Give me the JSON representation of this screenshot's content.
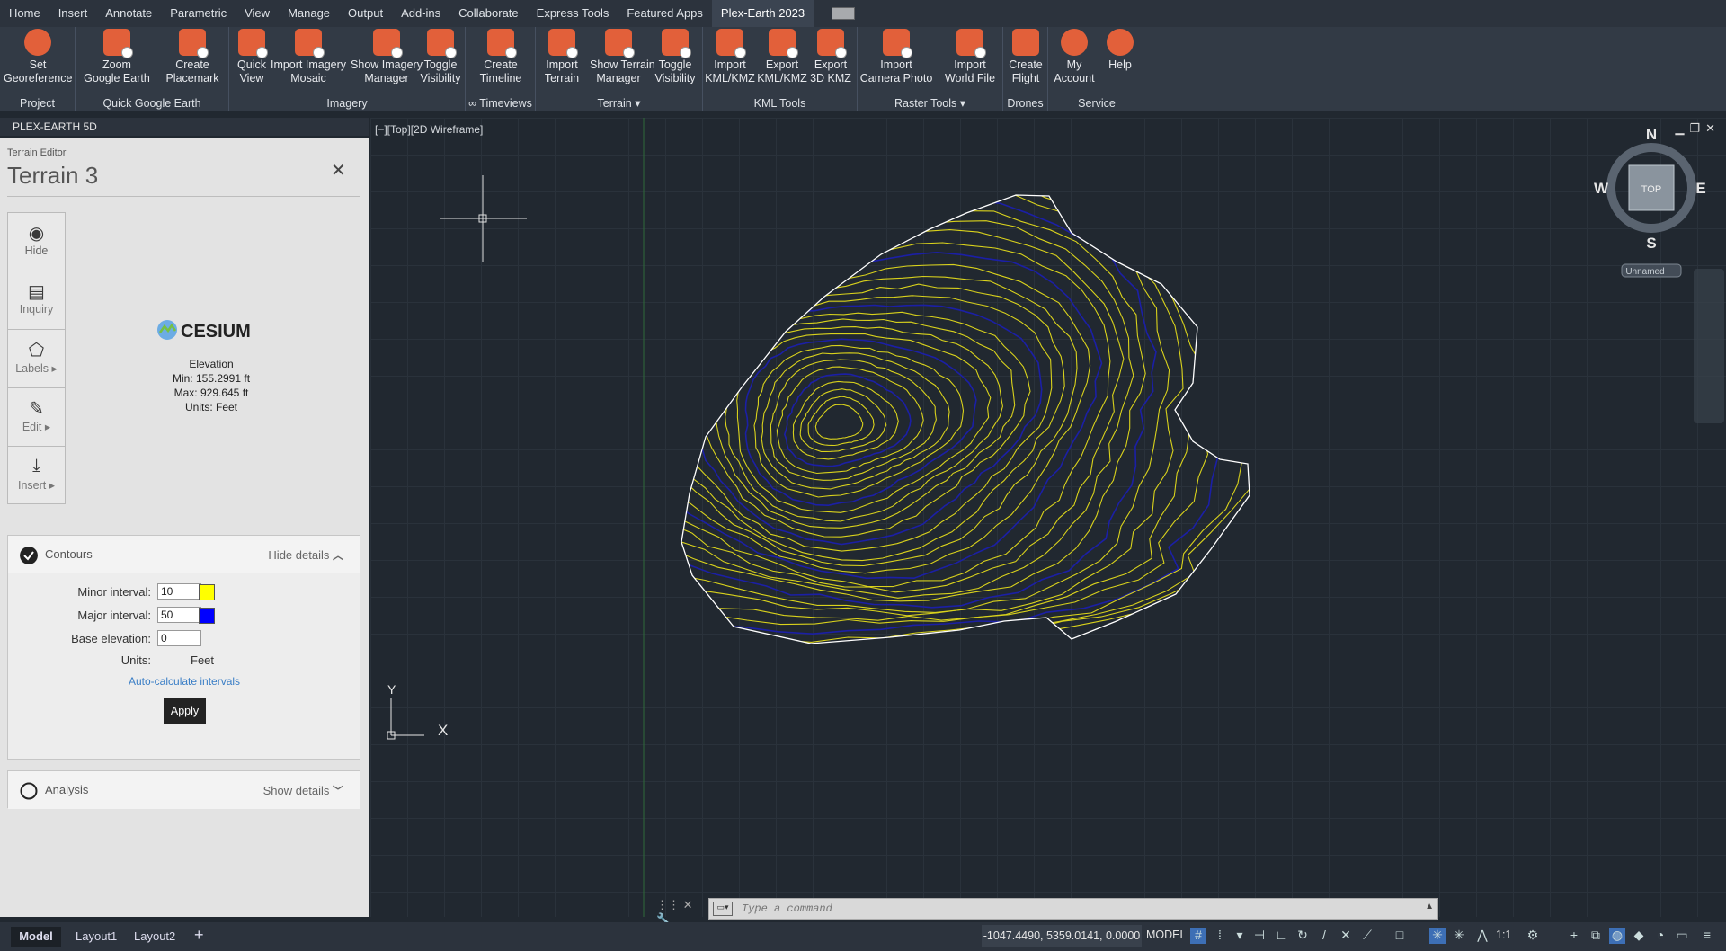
{
  "menubar": {
    "tabs": [
      "Home",
      "Insert",
      "Annotate",
      "Parametric",
      "View",
      "Manage",
      "Output",
      "Add-ins",
      "Collaborate",
      "Express Tools",
      "Featured Apps",
      "Plex-Earth 2023"
    ]
  },
  "ribbon": {
    "groups": {
      "project": "Project",
      "quick_google_earth": "Quick Google Earth",
      "imagery": "Imagery",
      "timeviews": "∞ Timeviews",
      "terrain": "Terrain",
      "kml_tools": "KML Tools",
      "raster_tools": "Raster Tools",
      "drones": "Drones",
      "service": "Service"
    },
    "buttons": {
      "set_georeference": [
        "Set",
        "Georeference"
      ],
      "zoom_google_earth": [
        "Zoom",
        "Google Earth"
      ],
      "create_placemark": [
        "Create",
        "Placemark"
      ],
      "quick_view": [
        "Quick",
        "View"
      ],
      "import_imagery_mosaic": [
        "Import Imagery",
        "Mosaic"
      ],
      "show_imagery_manager": [
        "Show Imagery",
        "Manager"
      ],
      "toggle_visibility_imagery": [
        "Toggle",
        "Visibility"
      ],
      "create_timeline": [
        "Create",
        "Timeline"
      ],
      "import_terrain": [
        "Import",
        "Terrain"
      ],
      "show_terrain_manager": [
        "Show Terrain",
        "Manager"
      ],
      "toggle_visibility_terrain": [
        "Toggle",
        "Visibility"
      ],
      "import_kml": [
        "Import",
        "KML/KMZ"
      ],
      "export_kml": [
        "Export",
        "KML/KMZ"
      ],
      "export_3d_kmz": [
        "Export",
        "3D KMZ"
      ],
      "import_camera_photo": [
        "Import",
        "Camera Photo"
      ],
      "import_world_file": [
        "Import",
        "World File"
      ],
      "create_flight": [
        "Create",
        "Flight"
      ],
      "my_account": [
        "My",
        "Account"
      ],
      "help": [
        "Help",
        ""
      ]
    }
  },
  "panel": {
    "title_bar": "PLEX-EARTH 5D",
    "editor_label": "Terrain Editor",
    "terrain_name": "Terrain 3",
    "close": "✕",
    "tools": [
      "Hide",
      "Inquiry",
      "Labels ▸",
      "Edit ▸",
      "Insert ▸"
    ],
    "provider_logo": "CESIUM",
    "elevation": {
      "heading": "Elevation",
      "min": "Min: 155.2991 ft",
      "max": "Max: 929.645 ft",
      "units": "Units: Feet"
    },
    "contours": {
      "title": "Contours",
      "toggle": "Hide details",
      "minor_label": "Minor interval:",
      "minor_value": "10",
      "minor_color": "#ffff00",
      "major_label": "Major interval:",
      "major_value": "50",
      "major_color": "#0000ff",
      "base_label": "Base elevation:",
      "base_value": "0",
      "units_label": "Units:",
      "units_value": "Feet",
      "auto_link": "Auto-calculate intervals",
      "apply": "Apply"
    },
    "analysis": {
      "title": "Analysis",
      "toggle": "Show details"
    }
  },
  "viewport": {
    "label": "[−][Top][2D Wireframe]",
    "viewcube": {
      "top": "TOP",
      "n": "N",
      "s": "S",
      "e": "E",
      "w": "W",
      "ucs": "Unnamed"
    },
    "axis_y": "Y",
    "axis_x": "X",
    "minor_contour_color": "#d9d21c",
    "major_contour_color": "#1b1fa6",
    "boundary_color": "#ffffff"
  },
  "command": {
    "placeholder": "Type a command"
  },
  "statusbar": {
    "layout_tabs": [
      "Model",
      "Layout1",
      "Layout2"
    ],
    "add_tab": "+",
    "coordinates": "-1047.4490, 5359.0141, 0.0000",
    "space": "MODEL",
    "scale": "1:1"
  },
  "colors": {
    "accent": "#e2603a",
    "ribbon_bg": "#323a45",
    "canvas_bg": "#212830"
  }
}
